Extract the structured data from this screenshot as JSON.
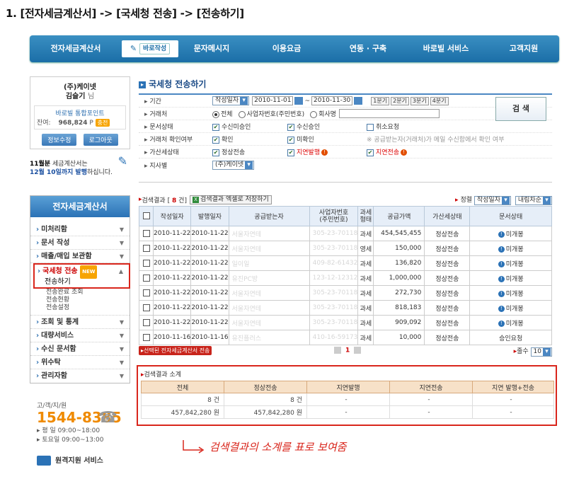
{
  "heading": "1. [전자세금계산서] -> [국세청 전송] -> [전송하기]",
  "topnav": {
    "items": [
      "전자세금계산서",
      "바로작성",
      "문자메시지",
      "이용요금",
      "연동 · 구축",
      "바로빌 서비스",
      "고객지원"
    ]
  },
  "user": {
    "company": "(주)케이넷",
    "name": "김슬기",
    "honorific": "님",
    "points_label": "바로빌 통합포인트",
    "balance_label": "잔여:",
    "balance": "968,824",
    "balance_unit": "P",
    "charge_label": "충전",
    "edit_label": "정보수정",
    "logout_label": "로그아웃"
  },
  "notice": {
    "line1_bold": "11월분",
    "line1": " 세금계산서는",
    "line2_red": "12월 10일까지 발행",
    "line2": "하십니다."
  },
  "leftmenu": {
    "header": "전자세금계산서",
    "items": [
      "미처리함",
      "문서 작성",
      "매출/매입 보관함",
      "국세청 전송",
      "조회 및 통계",
      "대량서비스",
      "수신 문서함",
      "위수탁",
      "관리자함"
    ],
    "new_badge": "NEW",
    "sub": [
      "전송하기",
      "전송완료 조회",
      "전송현황",
      "전송설정"
    ]
  },
  "contact": {
    "label": "고/객/지/원",
    "phone": "1544-8385",
    "weekday": "▸ 평 일  09:00~18:00",
    "saturday": "▸ 토요일  09:00~13:00",
    "remote": "원격지원 서비스"
  },
  "section_title": "국세청 전송하기",
  "filter": {
    "period_label": "기간",
    "period_select": "작성일자",
    "date_from": "2010-11-01",
    "date_sep": "~",
    "date_to": "2010-11-30",
    "quick": [
      "1분기",
      "2분기",
      "3분기",
      "4분기"
    ],
    "partner_label": "거래처",
    "partner_opts": [
      "전체",
      "사업자번호(주민번호)",
      "회사명"
    ],
    "doc_status_label": "문서상태",
    "doc_status_opts": [
      "수신미승인",
      "수신승인",
      "취소요청"
    ],
    "confirm_label": "거래처 확인여부",
    "confirm_opts": [
      "확인",
      "미확인"
    ],
    "confirm_note": "※ 공급받는자(거래처)가 메일 수신함에서 확인 여부",
    "tax_status_label": "가산세상태",
    "tax_status_opts": [
      "정상전송",
      "지연발행",
      "지연전송"
    ],
    "branch_label": "지사별",
    "branch_select": "(주)케이넷",
    "search_button": "검 색"
  },
  "results": {
    "label": "검색결과",
    "count": "8",
    "count_unit": "건",
    "excel_button": "검색결과 엑셀로 저장하기",
    "sort_label": "정렬",
    "sort_field": "작성일자",
    "sort_order": "내림차순"
  },
  "table": {
    "headers": [
      "작성일자",
      "발행일자",
      "공급받는자",
      "사업자번호\n(주민번호)",
      "과세\n형태",
      "공급가액",
      "가산세상태",
      "문서상태"
    ],
    "rows": [
      [
        "2010-11-22",
        "2010-11-22",
        "서울자연테",
        "305-23-70118",
        "과세",
        "454,545,455",
        "정상전송",
        "미개봉"
      ],
      [
        "2010-11-22",
        "2010-11-22",
        "서울자연테",
        "305-23-70118",
        "영세",
        "150,000",
        "정상전송",
        "미개봉"
      ],
      [
        "2010-11-22",
        "2010-11-22",
        "일이일",
        "409-82-61432",
        "과세",
        "136,820",
        "정상전송",
        "미개봉"
      ],
      [
        "2010-11-22",
        "2010-11-22",
        "유진PC방",
        "123-12-12312",
        "과세",
        "1,000,000",
        "정상전송",
        "미개봉"
      ],
      [
        "2010-11-22",
        "2010-11-22",
        "서울자연테",
        "305-23-70118",
        "과세",
        "272,730",
        "정상전송",
        "미개봉"
      ],
      [
        "2010-11-22",
        "2010-11-22",
        "서울자연테",
        "305-23-70118",
        "과세",
        "818,183",
        "정상전송",
        "미개봉"
      ],
      [
        "2010-11-22",
        "2010-11-22",
        "서울자연테",
        "305-23-70118",
        "과세",
        "909,092",
        "정상전송",
        "미개봉"
      ],
      [
        "2010-11-16",
        "2010-11-16",
        "유진플러스",
        "410-16-59173",
        "과세",
        "10,000",
        "정상전송",
        "승인요청"
      ]
    ]
  },
  "bottom": {
    "send_button": "선택된 전자세금계산서 전송",
    "page": "1",
    "rows_label": "줄수",
    "rows_value": "10"
  },
  "summary": {
    "title": "검색결과 소계",
    "headers": [
      "전체",
      "정상전송",
      "지연발행",
      "지연전송",
      "지연 발행+전송"
    ],
    "count_row": [
      "8 건",
      "8 건",
      "-",
      "-",
      "-"
    ],
    "amount_row": [
      "457,842,280 원",
      "457,842,280 원",
      "-",
      "-",
      "-"
    ]
  },
  "annotation": "검색결과의 소계를 표로 보여줌",
  "colors": {
    "nav": "#1b6ea7",
    "highlight": "#d9261c",
    "accent_orange": "#ef8a00"
  }
}
